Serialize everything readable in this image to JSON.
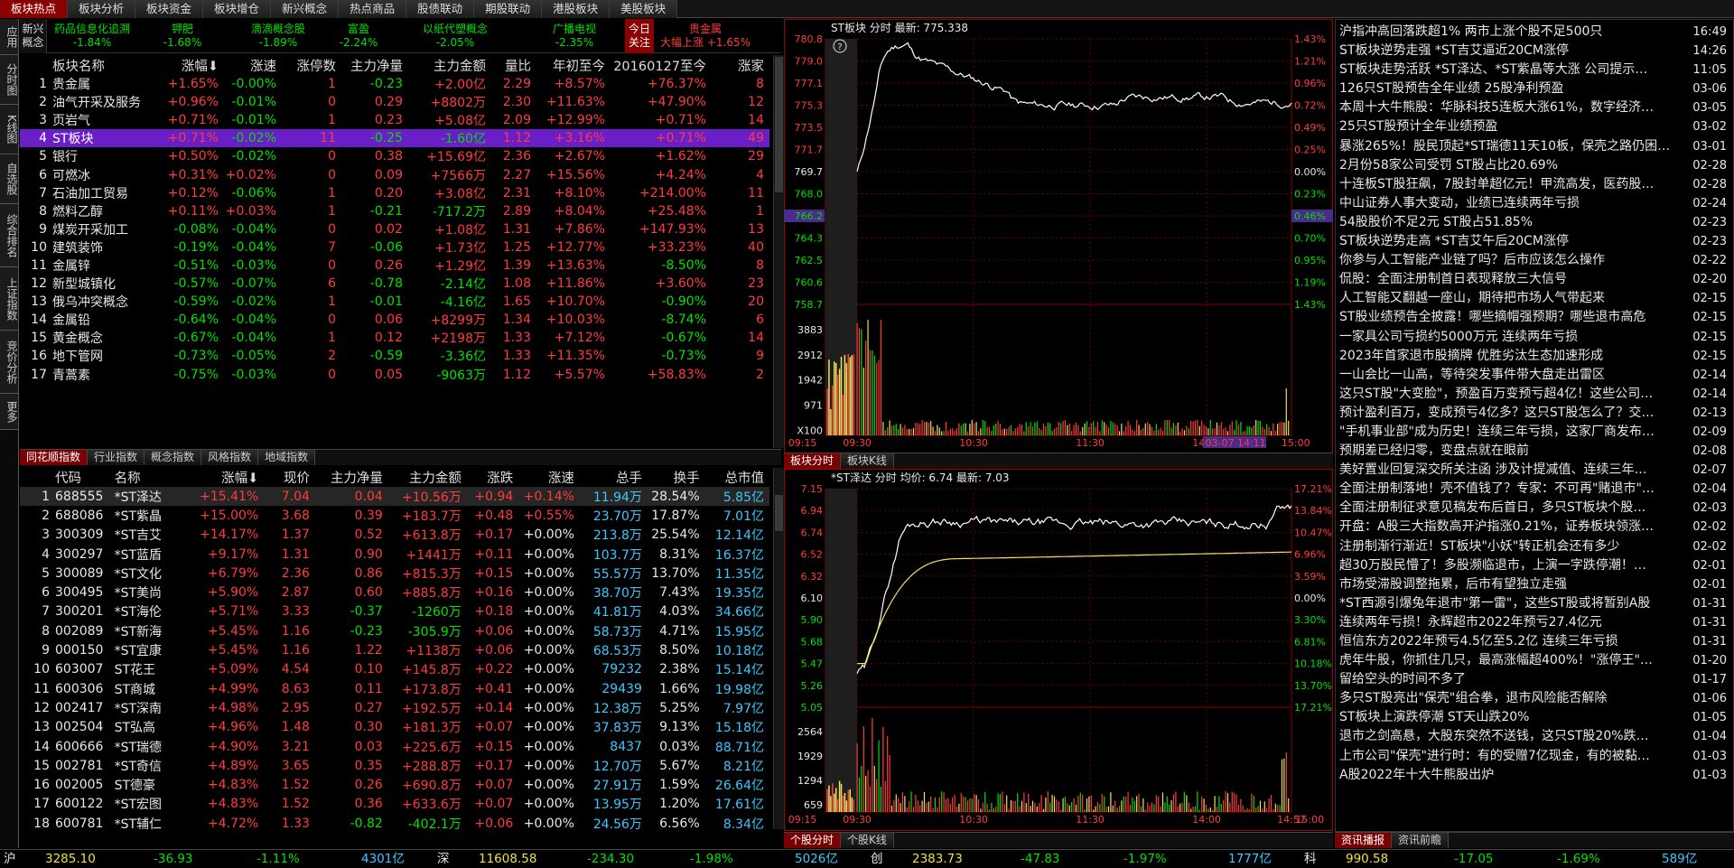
{
  "top_tabs": [
    "板块热点",
    "板块分析",
    "板块资金",
    "板块增仓",
    "新兴概念",
    "热点商品",
    "股债联动",
    "期股联动",
    "港股板块",
    "美股板块"
  ],
  "left_bar": [
    "应用",
    "分时图",
    "K线图",
    "自选股",
    "综合排名",
    "上证指数",
    "竞价分析",
    "更多"
  ],
  "concept_label": "新兴概念",
  "concepts": [
    {
      "name": "药品信息化追溯",
      "pct": "-1.84%"
    },
    {
      "name": "钾肥",
      "pct": "-1.68%"
    },
    {
      "name": "滴滴概念股",
      "pct": "-1.89%"
    },
    {
      "name": "富盈",
      "pct": "-2.24%"
    },
    {
      "name": "以纸代塑概念",
      "pct": "-2.05%"
    },
    {
      "name": "广播电视",
      "pct": "-2.35%"
    }
  ],
  "focus": {
    "label": "今日关注",
    "name": "贵金属",
    "desc": "大幅上涨",
    "pct": "+1.65%"
  },
  "plate_headers": [
    "",
    "板块名称",
    "涨幅",
    "涨速",
    "涨停数",
    "主力净量",
    "主力金额",
    "量比",
    "年初至今",
    "20160127至今",
    "涨家"
  ],
  "plates": [
    [
      "1",
      "贵金属",
      "+1.65%",
      "-0.00%",
      "1",
      "-0.23",
      "+2.00亿",
      "2.29",
      "+8.57%",
      "+76.37%",
      "8"
    ],
    [
      "2",
      "油气开采及服务",
      "+0.96%",
      "-0.01%",
      "0",
      "0.29",
      "+8802万",
      "2.30",
      "+11.63%",
      "+47.90%",
      "12"
    ],
    [
      "3",
      "页岩气",
      "+0.71%",
      "-0.01%",
      "1",
      "0.23",
      "+5.08亿",
      "2.09",
      "+12.99%",
      "+0.71%",
      "14"
    ],
    [
      "4",
      "ST板块",
      "+0.71%",
      "-0.02%",
      "11",
      "-0.25",
      "-1.60亿",
      "1.12",
      "+3.16%",
      "+0.71%",
      "49"
    ],
    [
      "5",
      "银行",
      "+0.50%",
      "-0.02%",
      "0",
      "0.38",
      "+15.69亿",
      "2.36",
      "+2.67%",
      "+1.62%",
      "29"
    ],
    [
      "6",
      "可燃冰",
      "+0.31%",
      "+0.02%",
      "0",
      "0.09",
      "+7566万",
      "2.27",
      "+15.56%",
      "+4.24%",
      "4"
    ],
    [
      "7",
      "石油加工贸易",
      "+0.12%",
      "-0.06%",
      "1",
      "0.20",
      "+3.08亿",
      "2.31",
      "+8.10%",
      "+214.00%",
      "11"
    ],
    [
      "8",
      "燃料乙醇",
      "+0.11%",
      "+0.03%",
      "1",
      "-0.21",
      "-717.2万",
      "2.89",
      "+8.04%",
      "+25.48%",
      "1"
    ],
    [
      "9",
      "煤炭开采加工",
      "-0.08%",
      "-0.04%",
      "0",
      "0.02",
      "+1.08亿",
      "1.31",
      "+7.86%",
      "+147.93%",
      "13"
    ],
    [
      "10",
      "建筑装饰",
      "-0.19%",
      "-0.04%",
      "7",
      "-0.06",
      "+1.73亿",
      "1.25",
      "+12.77%",
      "+33.23%",
      "40"
    ],
    [
      "11",
      "金属锌",
      "-0.51%",
      "-0.03%",
      "0",
      "0.26",
      "+1.29亿",
      "1.39",
      "+13.63%",
      "-8.50%",
      "8"
    ],
    [
      "12",
      "新型城镇化",
      "-0.57%",
      "-0.07%",
      "6",
      "-0.78",
      "-2.14亿",
      "1.08",
      "+11.86%",
      "+3.60%",
      "23"
    ],
    [
      "13",
      "俄乌冲突概念",
      "-0.59%",
      "-0.02%",
      "1",
      "-0.01",
      "-4.16亿",
      "1.65",
      "+10.70%",
      "-0.90%",
      "20"
    ],
    [
      "14",
      "金属铅",
      "-0.64%",
      "-0.04%",
      "0",
      "0.06",
      "+8299万",
      "1.34",
      "+10.03%",
      "-8.74%",
      "6"
    ],
    [
      "15",
      "黄金概念",
      "-0.67%",
      "-0.04%",
      "1",
      "0.12",
      "+2198万",
      "1.33",
      "+7.12%",
      "-0.67%",
      "14"
    ],
    [
      "16",
      "地下管网",
      "-0.73%",
      "-0.05%",
      "2",
      "-0.59",
      "-3.36亿",
      "1.33",
      "+11.35%",
      "-0.73%",
      "9"
    ],
    [
      "17",
      "青蒿素",
      "-0.75%",
      "-0.03%",
      "0",
      "0.05",
      "-9063万",
      "1.12",
      "+5.57%",
      "+58.83%",
      "2"
    ]
  ],
  "index_tabs": [
    "同花顺指数",
    "行业指数",
    "概念指数",
    "风格指数",
    "地域指数"
  ],
  "stock_headers": [
    "",
    "代码",
    "名称",
    "涨幅",
    "现价",
    "主力净量",
    "主力金额",
    "涨跌",
    "涨速",
    "总手",
    "换手",
    "总市值"
  ],
  "stocks": [
    [
      "1",
      "688555",
      "*ST泽达",
      "+15.41%",
      "7.04",
      "0.04",
      "+10.56万",
      "+0.94",
      "+0.14%",
      "11.94万",
      "28.54%",
      "5.85亿"
    ],
    [
      "2",
      "688086",
      "*ST紫晶",
      "+15.00%",
      "3.68",
      "0.39",
      "+183.7万",
      "+0.48",
      "+0.55%",
      "23.70万",
      "17.87%",
      "7.01亿"
    ],
    [
      "3",
      "300309",
      "*ST吉艾",
      "+14.17%",
      "1.37",
      "0.52",
      "+613.8万",
      "+0.17",
      "+0.00%",
      "213.8万",
      "25.54%",
      "12.14亿"
    ],
    [
      "4",
      "300297",
      "*ST蓝盾",
      "+9.17%",
      "1.31",
      "0.90",
      "+1441万",
      "+0.11",
      "+0.00%",
      "103.7万",
      "8.31%",
      "16.37亿"
    ],
    [
      "5",
      "300089",
      "*ST文化",
      "+6.79%",
      "2.36",
      "0.86",
      "+815.3万",
      "+0.15",
      "+0.00%",
      "55.57万",
      "13.70%",
      "11.35亿"
    ],
    [
      "6",
      "300495",
      "*ST美尚",
      "+5.90%",
      "2.87",
      "0.60",
      "+885.8万",
      "+0.16",
      "+0.00%",
      "38.70万",
      "7.43%",
      "19.35亿"
    ],
    [
      "7",
      "300201",
      "*ST海伦",
      "+5.71%",
      "3.33",
      "-0.37",
      "-1260万",
      "+0.18",
      "+0.00%",
      "41.81万",
      "4.03%",
      "34.66亿"
    ],
    [
      "8",
      "002089",
      "*ST新海",
      "+5.45%",
      "1.16",
      "-0.23",
      "-305.9万",
      "+0.06",
      "+0.00%",
      "58.73万",
      "4.71%",
      "15.95亿"
    ],
    [
      "9",
      "000150",
      "*ST宜康",
      "+5.45%",
      "1.16",
      "1.22",
      "+1138万",
      "+0.06",
      "+0.00%",
      "68.53万",
      "8.50%",
      "10.18亿"
    ],
    [
      "10",
      "603007",
      "ST花王",
      "+5.09%",
      "4.54",
      "0.10",
      "+145.8万",
      "+0.22",
      "+0.00%",
      "79232",
      "2.38%",
      "15.14亿"
    ],
    [
      "11",
      "600306",
      "ST商城",
      "+4.99%",
      "8.63",
      "0.11",
      "+173.8万",
      "+0.41",
      "+0.00%",
      "29439",
      "1.66%",
      "19.98亿"
    ],
    [
      "12",
      "002417",
      "*ST深南",
      "+4.98%",
      "2.95",
      "0.27",
      "+192.5万",
      "+0.14",
      "+0.00%",
      "12.38万",
      "5.25%",
      "7.97亿"
    ],
    [
      "13",
      "002504",
      "ST弘高",
      "+4.96%",
      "1.48",
      "0.30",
      "+181.3万",
      "+0.07",
      "+0.00%",
      "37.83万",
      "9.13%",
      "15.18亿"
    ],
    [
      "14",
      "600666",
      "*ST瑞德",
      "+4.90%",
      "3.21",
      "0.03",
      "+225.6万",
      "+0.15",
      "+0.00%",
      "8437",
      "0.03%",
      "88.71亿"
    ],
    [
      "15",
      "002781",
      "*ST奇信",
      "+4.89%",
      "3.65",
      "0.35",
      "+288.8万",
      "+0.17",
      "+0.00%",
      "12.70万",
      "5.67%",
      "8.21亿"
    ],
    [
      "16",
      "002005",
      "ST德豪",
      "+4.83%",
      "1.52",
      "0.26",
      "+690.8万",
      "+0.07",
      "+0.00%",
      "27.91万",
      "1.59%",
      "26.64亿"
    ],
    [
      "17",
      "600122",
      "*ST宏图",
      "+4.83%",
      "1.52",
      "0.36",
      "+633.6万",
      "+0.07",
      "+0.00%",
      "13.95万",
      "1.20%",
      "17.61亿"
    ],
    [
      "18",
      "600781",
      "*ST辅仁",
      "+4.72%",
      "1.33",
      "-0.82",
      "-402.1万",
      "+0.06",
      "+0.00%",
      "24.56万",
      "6.56%",
      "8.34亿"
    ]
  ],
  "chart1": {
    "title": "ST板块 分时 最新: 775.338",
    "yticks_left": [
      "780.8",
      "779.0",
      "777.1",
      "775.3",
      "773.5",
      "771.7",
      "769.7",
      "768.0",
      "766.2",
      "764.3",
      "762.5",
      "760.6",
      "758.7"
    ],
    "yticks_right": [
      "1.43%",
      "1.21%",
      "0.96%",
      "0.72%",
      "0.49%",
      "0.25%",
      "0.00%",
      "0.23%",
      "0.46%",
      "0.70%",
      "0.95%",
      "1.19%",
      "1.43%"
    ],
    "vol_ticks": [
      "3883",
      "2912",
      "1942",
      "971",
      "X100"
    ],
    "times": [
      "09:15",
      "09:30",
      "10:30",
      "11:30",
      "14:00",
      "15:00"
    ],
    "cursor_time": "03-07 14:11",
    "tabs": [
      "板块分时",
      "板块K线"
    ]
  },
  "chart2": {
    "title": "*ST泽达 分时 均价: 6.74 最新: 7.03",
    "yticks_left": [
      "7.15",
      "6.94",
      "6.74",
      "6.52",
      "6.32",
      "6.10",
      "5.90",
      "5.68",
      "5.47",
      "5.26",
      "5.05"
    ],
    "yticks_right": [
      "17.21%",
      "13.84%",
      "10.47%",
      "6.96%",
      "3.59%",
      "0.00%",
      "3.30%",
      "6.81%",
      "10.18%",
      "13.70%",
      "17.21%"
    ],
    "vol_ticks": [
      "2564",
      "1929",
      "1294",
      "659"
    ],
    "times": [
      "09:15",
      "09:30",
      "10:30",
      "11:30",
      "14:00",
      "14:57",
      "15:00"
    ],
    "tabs": [
      "个股分时",
      "个股K线"
    ]
  },
  "news": [
    [
      "沪指冲高回落跌超1% 两市上涨个股不足500只",
      "16:49"
    ],
    [
      "ST板块逆势走强 *ST吉艾逼近20CM涨停",
      "14:26"
    ],
    [
      "ST板块走势活跃 *ST泽达、*ST紫晶等大涨 公司提示…",
      "11:05"
    ],
    [
      "126只ST股预告全年业绩 25股净利预盈",
      "03-06"
    ],
    [
      "本周十大牛熊股：华脉科技5连板大涨61%，数字经济…",
      "03-05"
    ],
    [
      "25只ST股预计全年业绩预盈",
      "03-02"
    ],
    [
      "暴涨265%！股民顶起*ST瑞德11天10板，保壳之路仍困…",
      "03-01"
    ],
    [
      "2月份58家公司受罚 ST股占比20.69%",
      "02-28"
    ],
    [
      "十连板ST股狂飙，7股封单超亿元！甲流高发，医药股…",
      "02-28"
    ],
    [
      "中山证券人事大变动，业绩已连续两年亏损",
      "02-24"
    ],
    [
      "54股股价不足2元 ST股占51.85%",
      "02-23"
    ],
    [
      "ST板块逆势走高 *ST吉艾午后20CM涨停",
      "02-23"
    ],
    [
      "你参与人工智能产业链了吗？后市应该怎么操作",
      "02-22"
    ],
    [
      "侃股：全面注册制首日表现释放三大信号",
      "02-20"
    ],
    [
      "人工智能又翻越一座山，期待把市场人气带起来",
      "02-15"
    ],
    [
      "ST股业绩预告全披露！哪些摘帽强预期？哪些退市高危",
      "02-15"
    ],
    [
      "一家具公司亏损约5000万元 连续两年亏损",
      "02-15"
    ],
    [
      "2023年首家退市股摘牌 优胜劣汰生态加速形成",
      "02-15"
    ],
    [
      "一山会比一山高，等待突发事件带大盘走出雷区",
      "02-14"
    ],
    [
      "这只ST股\"大变脸\"，预盈百万变预亏超4亿！这些公司…",
      "02-14"
    ],
    [
      "预计盈利百万，变成预亏4亿多？这只ST股怎么了？交…",
      "02-13"
    ],
    [
      "\"手机事业部\"成为历史！连续三年亏损，这家厂商发布…",
      "02-09"
    ],
    [
      "预期差已经归零，变盘点就在眼前",
      "02-08"
    ],
    [
      "美好置业回复深交所关注函 涉及计提减值、连续三年…",
      "02-07"
    ],
    [
      "全面注册制落地！壳不值钱了？专家：不可再\"赌退市\"…",
      "02-04"
    ],
    [
      "全面注册制征求意见稿发布后首日，多只ST板块个股…",
      "02-03"
    ],
    [
      "开盘：A股三大指数高开沪指涨0.21%，证券板块领涨…",
      "02-02"
    ],
    [
      "注册制渐行渐近！ST板块\"小妖\"转正机会还有多少",
      "02-02"
    ],
    [
      "超30万股民懵了！多股濒临退市，上演一字跌停潮！…",
      "02-01"
    ],
    [
      "市场受滞股调整拖累，后市有望独立走强",
      "02-01"
    ],
    [
      "*ST西源引爆兔年退市\"第一雷\"，这些ST股或将暂别A股",
      "01-31"
    ],
    [
      "连续两年亏损！永辉超市2022年预亏27.4亿元",
      "01-31"
    ],
    [
      "恒信东方2022年预亏4.5亿至5.2亿 连续三年亏损",
      "01-31"
    ],
    [
      "虎年牛股，你抓住几只，最高涨幅超400%！\"涨停王\"…",
      "01-20"
    ],
    [
      "留给空头的时间不多了",
      "01-17"
    ],
    [
      "多只ST股亮出\"保壳\"组合拳，退市风险能否解除",
      "01-06"
    ],
    [
      "ST板块上演跌停潮 ST天山跌20%",
      "01-05"
    ],
    [
      "退市之剑高悬，大股东突然不送钱，这只ST股20%跌…",
      "01-04"
    ],
    [
      "上市公司\"保壳\"进行时：有的受赠7亿现金，有的被黏…",
      "01-03"
    ],
    [
      "A股2022年十大牛熊股出炉",
      "01-03"
    ]
  ],
  "news_tabs": [
    "资讯播报",
    "资讯前瞻"
  ],
  "indices": [
    {
      "name": "沪",
      "price": "3285.10",
      "chg": "-36.93",
      "pct": "-1.11%",
      "amt": "4301亿"
    },
    {
      "name": "深",
      "price": "11608.58",
      "chg": "-234.30",
      "pct": "-1.98%",
      "amt": "5026亿"
    },
    {
      "name": "创",
      "price": "2383.73",
      "chg": "-47.83",
      "pct": "-1.97%",
      "amt": "1777亿"
    },
    {
      "name": "科",
      "price": "990.58",
      "chg": "-17.05",
      "pct": "-1.69%",
      "amt": "589亿"
    }
  ],
  "colors": {
    "up": "#ff3c3c",
    "down": "#00e100",
    "accent": "#8b0000",
    "select": "#6a1ec8"
  }
}
